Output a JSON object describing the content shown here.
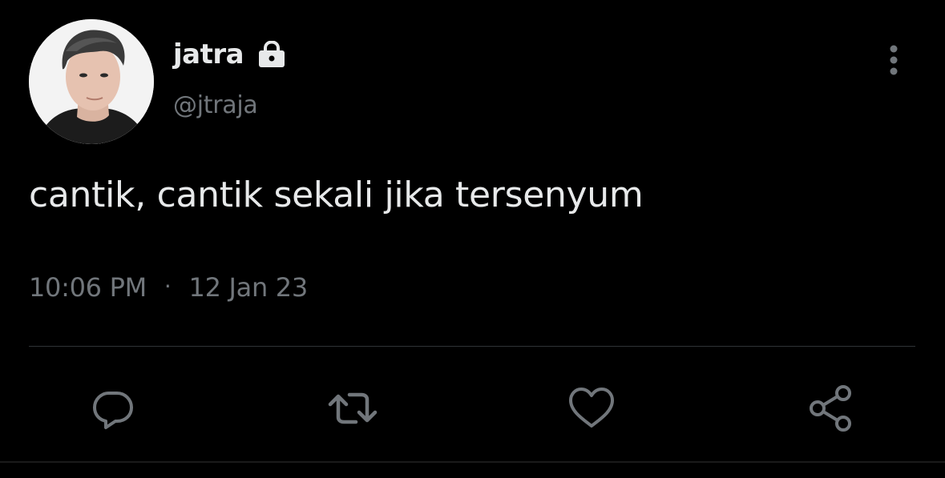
{
  "tweet": {
    "display_name": "jatra",
    "protected_icon": "lock-icon",
    "handle": "@jtraja",
    "text": "cantik, cantik sekali jika tersenyum",
    "time": "10:06 PM",
    "separator": "·",
    "date": "12 Jan 23"
  },
  "actions": {
    "reply_icon": "reply-icon",
    "retweet_icon": "retweet-icon",
    "like_icon": "heart-icon",
    "share_icon": "share-icon",
    "more_icon": "more-vertical-icon"
  },
  "colors": {
    "background": "#000000",
    "primary_text": "#e7e9ea",
    "secondary_text": "#71767b",
    "divider": "#2f3336"
  }
}
